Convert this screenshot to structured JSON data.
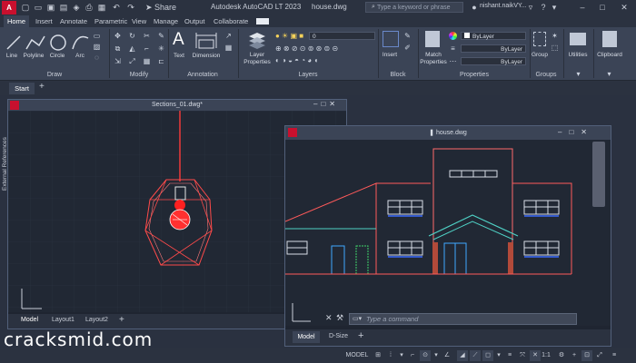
{
  "titlebar": {
    "app_logo": "A LT",
    "title": "Autodesk AutoCAD LT 2023",
    "filename": "house.dwg",
    "search_placeholder": "Type a keyword or phrase",
    "user": "nishant.naikVY...",
    "share_label": "Share"
  },
  "tabs": [
    "Home",
    "Insert",
    "Annotate",
    "Parametric",
    "View",
    "Manage",
    "Output",
    "Collaborate"
  ],
  "ribbon": {
    "draw": {
      "title": "Draw",
      "tools": [
        "Line",
        "Polyline",
        "Circle",
        "Arc"
      ]
    },
    "modify": {
      "title": "Modify"
    },
    "annotation": {
      "title": "Annotation",
      "tools": [
        "Text",
        "Dimension"
      ]
    },
    "layers": {
      "title": "Layers",
      "tool": "Layer Properties",
      "layer_value": "0"
    },
    "block": {
      "title": "Block",
      "tool": "Insert"
    },
    "properties": {
      "title": "Properties",
      "tool": "Match Properties",
      "bylayer1": "ByLayer",
      "bylayer2": "ByLayer",
      "bylayer3": "ByLayer"
    },
    "groups": {
      "title": "Groups",
      "tool": "Group"
    },
    "utilities": {
      "tool": "Utilities"
    },
    "clipboard": {
      "tool": "Clipboard"
    }
  },
  "filetabs": {
    "start": "Start",
    "add": "+"
  },
  "sections_window": {
    "title": "Sections_01.dwg*",
    "side_label": "External References",
    "layout_tabs": [
      "Model",
      "Layout1",
      "Layout2"
    ]
  },
  "house_window": {
    "title": "house.dwg",
    "command_placeholder": "Type a command",
    "layout_tabs": [
      "Model",
      "D-Size"
    ]
  },
  "statusbar": {
    "model": "MODEL",
    "scale": "1:1"
  },
  "watermark": "cracksmid.com",
  "colors": {
    "accent": "#c8102e",
    "ribbon_bg": "#3b4456",
    "canvas_bg": "#212834"
  }
}
